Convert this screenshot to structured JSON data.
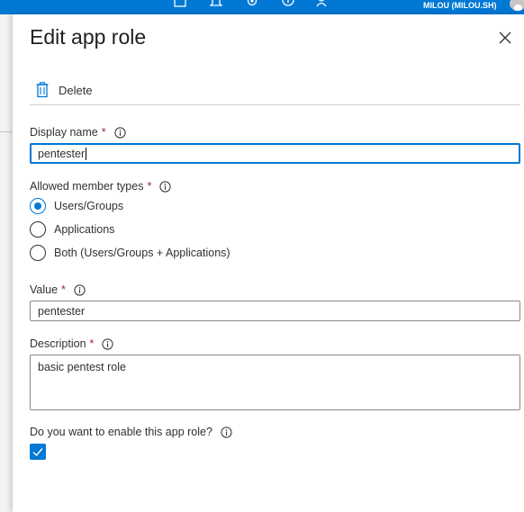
{
  "header": {
    "account_name": "MILOU (MILOU.SH)",
    "icons": [
      "cloud-shell-icon",
      "notifications-icon",
      "settings-icon",
      "help-icon",
      "feedback-icon"
    ]
  },
  "panel": {
    "title": "Edit app role",
    "close_icon": "close-icon",
    "toolbar": {
      "delete_label": "Delete",
      "delete_icon": "trash-icon"
    }
  },
  "form": {
    "display_name": {
      "label": "Display name",
      "required_mark": "*",
      "value": "pentester"
    },
    "member_types": {
      "label": "Allowed member types",
      "required_mark": "*",
      "options": [
        "Users/Groups",
        "Applications",
        "Both (Users/Groups + Applications)"
      ],
      "selected": "Users/Groups"
    },
    "value": {
      "label": "Value",
      "required_mark": "*",
      "value": "pentester"
    },
    "description": {
      "label": "Description",
      "required_mark": "*",
      "value": "basic pentest role"
    },
    "enable": {
      "label": "Do you want to enable this app role?",
      "checked": true
    }
  },
  "colors": {
    "accent": "#0078d4",
    "required": "#a4262c",
    "text": "#323130"
  }
}
